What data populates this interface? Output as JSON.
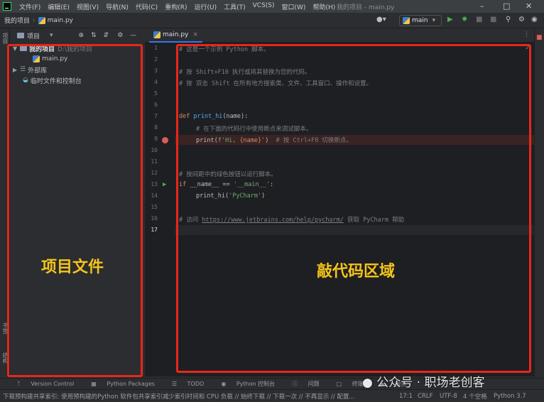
{
  "titlebar": {
    "menu": [
      "文件(F)",
      "编辑(E)",
      "视图(V)",
      "导航(N)",
      "代码(C)",
      "重构(R)",
      "运行(U)",
      "工具(T)",
      "VCS(S)",
      "窗口(W)",
      "帮助(H)"
    ],
    "window_title": "我的项目 - main.py"
  },
  "navbar": {
    "project": "我的项目",
    "file": "main.py",
    "run_config": "main"
  },
  "left_strip": {
    "project": "项目",
    "bookmarks": "书签",
    "structure": "结构"
  },
  "project_panel": {
    "title": "项目",
    "tree": [
      {
        "label": "我的项目",
        "path": "D:\\我的项目"
      },
      {
        "label": "main.py"
      },
      {
        "label": "外部库"
      },
      {
        "label": "临时文件和控制台"
      }
    ]
  },
  "editor": {
    "tab_label": "main.py",
    "line_numbers": [
      "1",
      "2",
      "3",
      "4",
      "5",
      "6",
      "7",
      "8",
      "9",
      "10",
      "11",
      "12",
      "13",
      "14",
      "15",
      "16",
      "17"
    ],
    "code": {
      "l1": "# 这是一个示例 Python 脚本。",
      "l3": "# 按 Shift+F10 执行或将其替换为您的代码。",
      "l4": "# 按 双击 Shift 在所有地方搜索类、文件、工具窗口、操作和设置。",
      "l7_kw": "def ",
      "l7_fn": "print_hi",
      "l7_rest": "(name):",
      "l8": "# 在下面的代码行中使用断点来调试脚本。",
      "l9_fn": "print",
      "l9_open": "(",
      "l9_str1": "f'Hi, ",
      "l9_brace": "{name}",
      "l9_str2": "'",
      "l9_close": ")",
      "l9_cm": "  # 按 Ctrl+F8 切换断点。",
      "l12": "# 按间距中的绿色按钮以运行脚本。",
      "l13_kw": "if ",
      "l13_rest": "__name__ == ",
      "l13_str": "'__main__'",
      "l13_colon": ":",
      "l14_fn": "print_hi",
      "l14_open": "(",
      "l14_str": "'PyCharm'",
      "l14_close": ")",
      "l16_pre": "# 访问 ",
      "l16_link": "https://www.jetbrains.com/help/pycharm/",
      "l16_post": " 获取 PyCharm 帮助"
    }
  },
  "bottom_tools": [
    "Version Control",
    "Python Packages",
    "TODO",
    "Python 控制台",
    "问题",
    "终端",
    "服务"
  ],
  "statusbar": {
    "message": "下载预构建共享索引: 使用预构建的Python 软件包共享索引减少索引时间和 CPU 负载 // 始终下载 // 下载一次 // 不再显示 // 配置...",
    "position": "17:1",
    "line_sep": "CRLF",
    "encoding": "UTF-8",
    "indent": "4 个空格",
    "interpreter": "Python 3.7"
  },
  "annotations": {
    "project_files": "项目文件",
    "code_area": "敲代码区域"
  },
  "watermark": "公众号 · 职场老创客",
  "colors": {
    "annotation_border": "#e8271b",
    "annotation_text": "#f5c518",
    "run_green": "#4caf50",
    "breakpoint_red": "#db5c5c"
  }
}
